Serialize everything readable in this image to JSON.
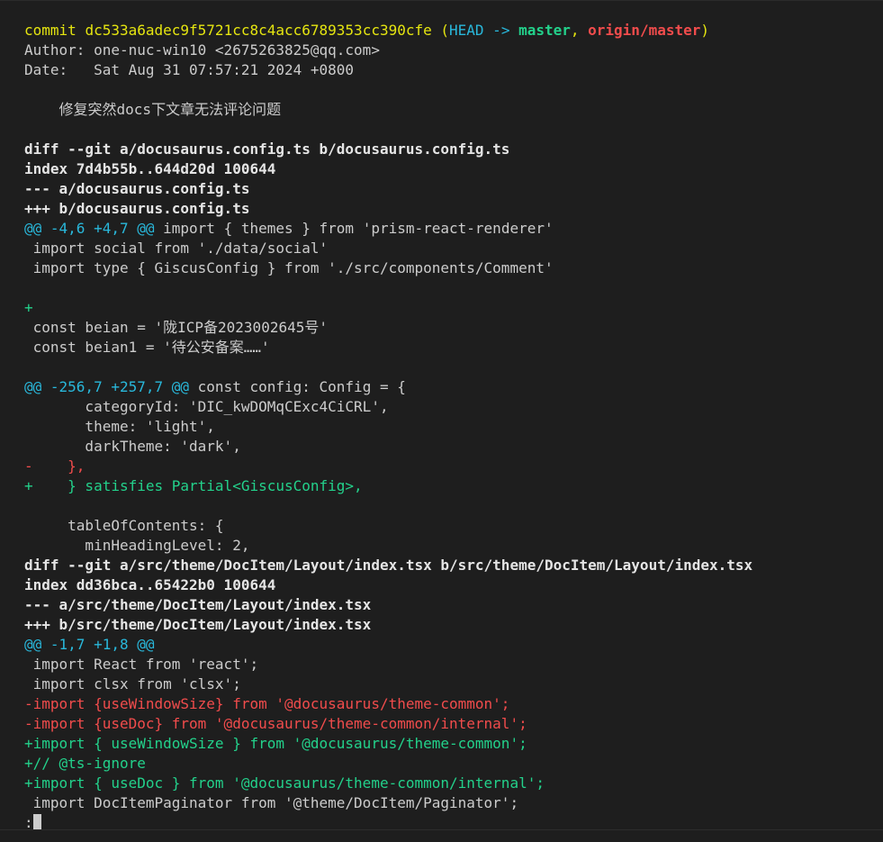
{
  "commit": {
    "label": "commit ",
    "hash": "dc533a6adec9f5721cc8c4acc6789353cc390cfe",
    "ref_open": " (",
    "head": "HEAD -> ",
    "branch": "master",
    "sep": ", ",
    "remote": "origin/master",
    "ref_close": ")",
    "author": "Author: one-nuc-win10 <2675263825@qq.com>",
    "date": "Date:   Sat Aug 31 07:57:21 2024 +0800",
    "message": "    修复突然docs下文章无法评论问题"
  },
  "diff1": {
    "header": "diff --git a/docusaurus.config.ts b/docusaurus.config.ts",
    "index": "index 7d4b55b..644d20d 100644",
    "from": "--- a/docusaurus.config.ts",
    "to": "+++ b/docusaurus.config.ts",
    "hunk1": {
      "range": "@@ -4,6 +4,7 @@",
      "context": " import { themes } from 'prism-react-renderer'"
    },
    "hunk1_lines": [
      " import social from './data/social'",
      " import type { GiscusConfig } from './src/components/Comment'"
    ],
    "added_empty": "+",
    "hunk1_tail": [
      " const beian = '陇ICP备2023002645号'",
      " const beian1 = '待公安备案……'"
    ],
    "hunk2": {
      "range": "@@ -256,7 +257,7 @@",
      "context": " const config: Config = {"
    },
    "hunk2_lines": [
      "       categoryId: 'DIC_kwDOMqCExc4CiCRL',",
      "       theme: 'light',",
      "       darkTheme: 'dark',"
    ],
    "removed": "-    },",
    "added": "+    } satisfies Partial<GiscusConfig>,",
    "hunk2_tail": [
      "     tableOfContents: {",
      "       minHeadingLevel: 2,"
    ]
  },
  "diff2": {
    "header": "diff --git a/src/theme/DocItem/Layout/index.tsx b/src/theme/DocItem/Layout/index.tsx",
    "index": "index dd36bca..65422b0 100644",
    "from": "--- a/src/theme/DocItem/Layout/index.tsx",
    "to": "+++ b/src/theme/DocItem/Layout/index.tsx",
    "hunk": "@@ -1,7 +1,8 @@",
    "context": [
      " import React from 'react';",
      " import clsx from 'clsx';"
    ],
    "removed": [
      "-import {useWindowSize} from '@docusaurus/theme-common';",
      "-import {useDoc} from '@docusaurus/theme-common/internal';"
    ],
    "added": [
      "+import { useWindowSize } from '@docusaurus/theme-common';",
      "+// @ts-ignore",
      "+import { useDoc } from '@docusaurus/theme-common/internal';"
    ],
    "tail": " import DocItemPaginator from '@theme/DocItem/Paginator';"
  },
  "prompt": ":"
}
